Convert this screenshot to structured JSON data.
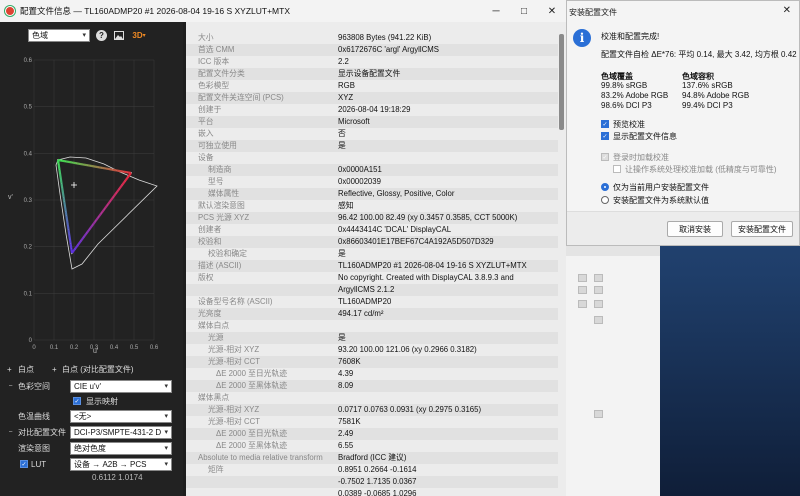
{
  "main_window": {
    "title": "配置文件信息 — TL160ADMP20 #1 2026-08-04 19-16 S XYZLUT+MTX",
    "minimize": "─",
    "maximize": "□",
    "close": "✕"
  },
  "left_panel": {
    "toolbar": {
      "view_select": "色域",
      "help": "?",
      "image": "🖼",
      "three_d": "3D"
    },
    "plot": {
      "x_label": "u'",
      "y_label": "v'",
      "x_ticks": [
        "0",
        "0.1",
        "0.2",
        "0.3",
        "0.4",
        "0.5",
        "0.6"
      ],
      "y_ticks": [
        "0",
        "0.1",
        "0.2",
        "0.3",
        "0.4",
        "0.5",
        "0.6"
      ]
    },
    "whitepoint_label": "白点",
    "whitepoint_alt_label": "白点 (对比配置文件)",
    "color_space_label": "色彩空间",
    "color_space_value": "CIE u'v'",
    "show_lut_label": "显示映射",
    "tone_curve_label": "色温曲线",
    "tone_curve_value": "<无>",
    "compare_profile_label": "对比配置文件",
    "compare_profile_value": "DCI-P3/SMPTE-431-2 D",
    "rendering_intent_label": "渲染意图",
    "rendering_intent_value": "绝对色度",
    "lut_label": "LUT",
    "lut_value": "设备 → A2B → PCS",
    "readout": "0.6112 1.0174"
  },
  "info_rows": [
    {
      "k": "大小",
      "v": "963808 Bytes (941.22 KiB)",
      "indent": 0
    },
    {
      "k": "首选 CMM",
      "v": "0x6172676C 'argl' ArgyllCMS",
      "indent": 0
    },
    {
      "k": "ICC 版本",
      "v": "2.2",
      "indent": 0
    },
    {
      "k": "配置文件分类",
      "v": "显示设备配置文件",
      "indent": 0
    },
    {
      "k": "色彩模型",
      "v": "RGB",
      "indent": 0
    },
    {
      "k": "配置文件关连空间 (PCS)",
      "v": "XYZ",
      "indent": 0
    },
    {
      "k": "创建于",
      "v": "2026-08-04 19:18:29",
      "indent": 0
    },
    {
      "k": "平台",
      "v": "Microsoft",
      "indent": 0
    },
    {
      "k": "嵌入",
      "v": "否",
      "indent": 0
    },
    {
      "k": "可独立使用",
      "v": "是",
      "indent": 0
    },
    {
      "k": "设备",
      "v": "",
      "indent": 0
    },
    {
      "k": "制造商",
      "v": "0x0000A151",
      "indent": 1
    },
    {
      "k": "型号",
      "v": "0x00002039",
      "indent": 1
    },
    {
      "k": "媒体属性",
      "v": "Reflective, Glossy, Positive, Color",
      "indent": 1
    },
    {
      "k": "默认渲染意图",
      "v": "感知",
      "indent": 0
    },
    {
      "k": "PCS 光源 XYZ",
      "v": "96.42 100.00  82.49 (xy 0.3457 0.3585, CCT 5000K)",
      "indent": 0
    },
    {
      "k": "创建者",
      "v": "0x4443414C 'DCAL' DisplayCAL",
      "indent": 0
    },
    {
      "k": "校验和",
      "v": "0x86603401E17BEF67C4A192A5D507D329",
      "indent": 0
    },
    {
      "k": "校验和确定",
      "v": "是",
      "indent": 1
    },
    {
      "k": "描述 (ASCII)",
      "v": "TL160ADMP20 #1 2026-08-04 19-16 S XYZLUT+MTX",
      "indent": 0
    },
    {
      "k": "版权",
      "v": "No copyright. Created with DisplayCAL 3.8.9.3 and",
      "indent": 0
    },
    {
      "k": "",
      "v": "ArgyllCMS 2.1.2",
      "indent": 0
    },
    {
      "k": "设备型号名称 (ASCII)",
      "v": "TL160ADMP20",
      "indent": 0
    },
    {
      "k": "光亮度",
      "v": "494.17 cd/m²",
      "indent": 0
    },
    {
      "k": "媒体白点",
      "v": "",
      "indent": 0
    },
    {
      "k": "光源",
      "v": "是",
      "indent": 1
    },
    {
      "k": "光源-相对 XYZ",
      "v": "93.20 100.00 121.06 (xy 0.2966 0.3182)",
      "indent": 1
    },
    {
      "k": "光源-相对 CCT",
      "v": "7608K",
      "indent": 1
    },
    {
      "k": "ΔE 2000 至日光轨迹",
      "v": "4.39",
      "indent": 2
    },
    {
      "k": "ΔE 2000 至黑体轨迹",
      "v": "8.09",
      "indent": 2
    },
    {
      "k": "媒体黑点",
      "v": "",
      "indent": 0
    },
    {
      "k": "光源-相对 XYZ",
      "v": "0.0717 0.0763 0.0931 (xy 0.2975 0.3165)",
      "indent": 1
    },
    {
      "k": "光源-相对 CCT",
      "v": "7581K",
      "indent": 1
    },
    {
      "k": "ΔE 2000 至日光轨迹",
      "v": "2.49",
      "indent": 2
    },
    {
      "k": "ΔE 2000 至黑体轨迹",
      "v": "6.55",
      "indent": 2
    },
    {
      "k": "Absolute to media relative transform",
      "v": "Bradford (ICC 建议)",
      "indent": 0
    },
    {
      "k": "矩阵",
      "v": "0.8951 0.2664 -0.1614",
      "indent": 1
    },
    {
      "k": "",
      "v": "-0.7502 1.7135 0.0367",
      "indent": 0
    },
    {
      "k": "",
      "v": "0.0389 -0.0685 1.0296",
      "indent": 0
    }
  ],
  "dialog": {
    "title": "安装配置文件",
    "close": "✕",
    "heading": "校准和配置完成!",
    "summary": "配置文件自检 ΔE*76: 平均 0.14, 最大 3.42, 均方根 0.42",
    "coverage_title": "色域覆盖",
    "coverage": [
      "99.8% sRGB",
      "83.2% Adobe RGB",
      "98.6% DCI P3"
    ],
    "volume_title": "色域容积",
    "volume": [
      "137.6% sRGB",
      "94.8% Adobe RGB",
      "99.4% DCI P3"
    ],
    "preview_calibration": "预览校准",
    "show_profile_info": "显示配置文件信息",
    "load_on_login": "登录时加载校准",
    "let_os_handle": "让操作系统处理校准加载 (低精度与可靠性)",
    "install_current_user": "仅为当前用户安装配置文件",
    "install_default": "安装配置文件为系统默认值",
    "cancel_button": "取消安装",
    "install_button": "安装配置文件"
  },
  "colors": {
    "accent": "#2b6fd6",
    "three_d": "#f08a24"
  }
}
